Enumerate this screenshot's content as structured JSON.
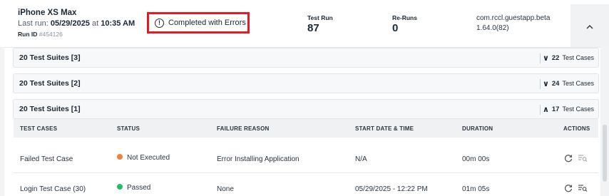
{
  "run": {
    "device": "iPhone XS Max",
    "last_run_label": "Last run:",
    "last_run_date": "05/29/2025",
    "last_run_at": "at",
    "last_run_time": "10:35 AM",
    "run_id_label": "Run ID",
    "run_id_value": "#454126",
    "status": "Completed with Errors",
    "status_icon": "exclamation-circle-icon",
    "test_run_label": "Test Run",
    "test_run_value": "87",
    "reruns_label": "Re-Runs",
    "reruns_value": "0",
    "app_id": "com.rccl.guestapp.beta",
    "app_version": "1.64.0(82)",
    "collapse_icon": "chevron-up-icon"
  },
  "suites": [
    {
      "title": "20 Test Suites [3]",
      "count": "22",
      "count_label": "Test Cases",
      "chevron": "∨"
    },
    {
      "title": "20 Test Suites [2]",
      "count": "24",
      "count_label": "Test Cases",
      "chevron": "∨"
    },
    {
      "title": "20 Test Suites [1]",
      "count": "17",
      "count_label": "Test Cases",
      "chevron": "∧"
    }
  ],
  "table": {
    "headers": {
      "test_cases": "TEST CASES",
      "status": "STATUS",
      "failure_reason": "FAILURE REASON",
      "start": "START DATE & TIME",
      "duration": "DURATION",
      "actions": "ACTIONS"
    },
    "rows": [
      {
        "name": "Failed Test Case",
        "status": "Not Executed",
        "status_color": "#f0803c",
        "failure": "Error Installing Application",
        "start": "N/A",
        "duration": "00m 00s"
      },
      {
        "name": "Login Test Case (30)",
        "status": "Passed",
        "status_color": "#1fbf6b",
        "failure": "None",
        "start": "05/29/2025 - 12:22 PM",
        "duration": "01m 05s"
      }
    ]
  }
}
